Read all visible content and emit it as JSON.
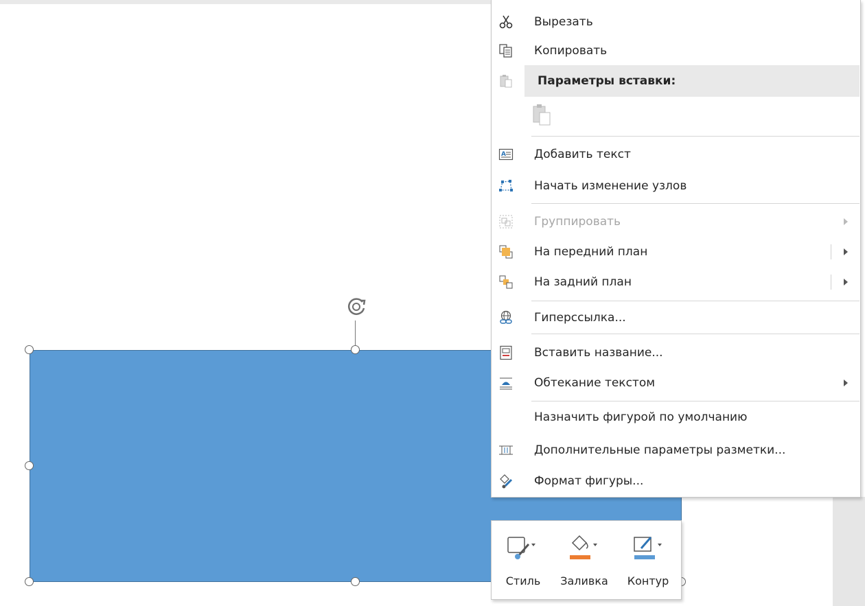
{
  "context_menu": {
    "items": [
      {
        "label": "Вырезать",
        "icon": "scissors-icon"
      },
      {
        "label": "Копировать",
        "icon": "copy-icon"
      },
      {
        "label": "Параметры вставки:",
        "icon": "paste-icon"
      },
      {
        "label": "Добавить текст",
        "icon": "add-text-icon"
      },
      {
        "label": "Начать изменение узлов",
        "icon": "edit-points-icon"
      },
      {
        "label": "Группировать",
        "icon": "group-icon",
        "disabled": true
      },
      {
        "label": "На передний план",
        "icon": "bring-forward-icon"
      },
      {
        "label": "На задний план",
        "icon": "send-backward-icon"
      },
      {
        "label": "Гиперссылка...",
        "icon": "hyperlink-icon"
      },
      {
        "label": "Вставить название...",
        "icon": "insert-caption-icon"
      },
      {
        "label": "Обтекание текстом",
        "icon": "wrap-text-icon"
      },
      {
        "label": "Назначить фигурой по умолчанию",
        "icon": ""
      },
      {
        "label": "Дополнительные параметры разметки...",
        "icon": "layout-options-icon"
      },
      {
        "label": "Формат фигуры...",
        "icon": "format-shape-icon"
      }
    ]
  },
  "mini_toolbar": {
    "style_label": "Стиль",
    "fill_label": "Заливка",
    "outline_label": "Контур"
  },
  "colors": {
    "shape_fill": "#5b9bd5",
    "fill_bar": "#ed7d31",
    "outline_bar": "#5b9bd5"
  }
}
